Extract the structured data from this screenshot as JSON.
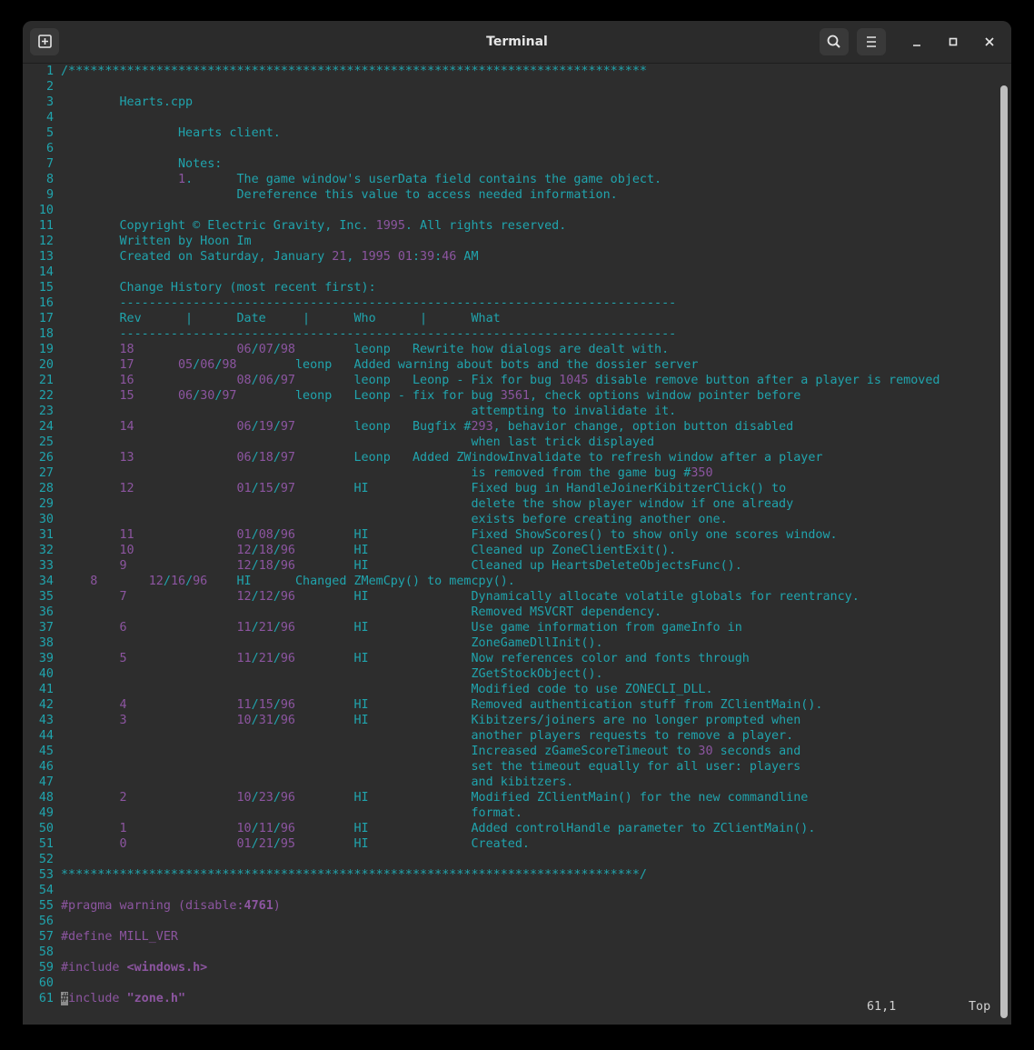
{
  "window": {
    "title": "Terminal",
    "min_icon": "minimize-icon",
    "max_icon": "maximize-icon",
    "close_icon": "close-icon"
  },
  "status": {
    "position": "61,1",
    "scroll": "Top"
  },
  "colors": {
    "comment": "#20a4ad",
    "number": "#8c55a0",
    "background": "#2d2d2d"
  },
  "lines": [
    "/*******************************************************************************",
    "",
    "        Hearts.cpp",
    "",
    "                Hearts client.",
    "",
    "                Notes:",
    "                1.      The game window's userData field contains the game object.",
    "                        Dereference this value to access needed information.",
    "",
    "        Copyright © Electric Gravity, Inc. 1995. All rights reserved.",
    "        Written by Hoon Im",
    "        Created on Saturday, January 21, 1995 01:39:46 AM",
    "",
    "        Change History (most recent first):",
    "        ----------------------------------------------------------------------------",
    "        Rev      |      Date     |      Who      |      What",
    "        ----------------------------------------------------------------------------",
    "        18              06/07/98        leonp   Rewrite how dialogs are dealt with.",
    "        17      05/06/98        leonp   Added warning about bots and the dossier server",
    "        16              08/06/97        leonp   Leonp - Fix for bug 1045 disable remove button after a player is removed",
    "        15      06/30/97        leonp   Leonp - fix for bug 3561, check options window pointer before",
    "                                                        attempting to invalidate it.",
    "        14              06/19/97        leonp   Bugfix #293, behavior change, option button disabled",
    "                                                        when last trick displayed",
    "        13              06/18/97        Leonp   Added ZWindowInvalidate to refresh window after a player",
    "                                                        is removed from the game bug #350",
    "        12              01/15/97        HI              Fixed bug in HandleJoinerKibitzerClick() to",
    "                                                        delete the show player window if one already",
    "                                                        exists before creating another one.",
    "        11              01/08/96        HI              Fixed ShowScores() to show only one scores window.",
    "        10              12/18/96        HI              Cleaned up ZoneClientExit().",
    "        9               12/18/96        HI              Cleaned up HeartsDeleteObjectsFunc().",
    "    8       12/16/96    HI      Changed ZMemCpy() to memcpy().",
    "        7               12/12/96        HI              Dynamically allocate volatile globals for reentrancy.",
    "                                                        Removed MSVCRT dependency.",
    "        6               11/21/96        HI              Use game information from gameInfo in",
    "                                                        ZoneGameDllInit().",
    "        5               11/21/96        HI              Now references color and fonts through",
    "                                                        ZGetStockObject().",
    "                                                        Modified code to use ZONECLI_DLL.",
    "        4               11/15/96        HI              Removed authentication stuff from ZClientMain().",
    "        3               10/31/96        HI              Kibitzers/joiners are no longer prompted when",
    "                                                        another players requests to remove a player.",
    "                                                        Increased zGameScoreTimeout to 30 seconds and",
    "                                                        set the timeout equally for all user: players",
    "                                                        and kibitzers.",
    "        2               10/23/96        HI              Modified ZClientMain() for the new commandline",
    "                                                        format.",
    "        1               10/11/96        HI              Added controlHandle parameter to ZClientMain().",
    "        0               01/21/95        HI              Created.",
    "",
    "*******************************************************************************/",
    "",
    "#pragma warning (disable:4761)",
    "",
    "#define MILL_VER",
    "",
    "#include <windows.h>",
    "",
    "#include \"zone.h\""
  ]
}
